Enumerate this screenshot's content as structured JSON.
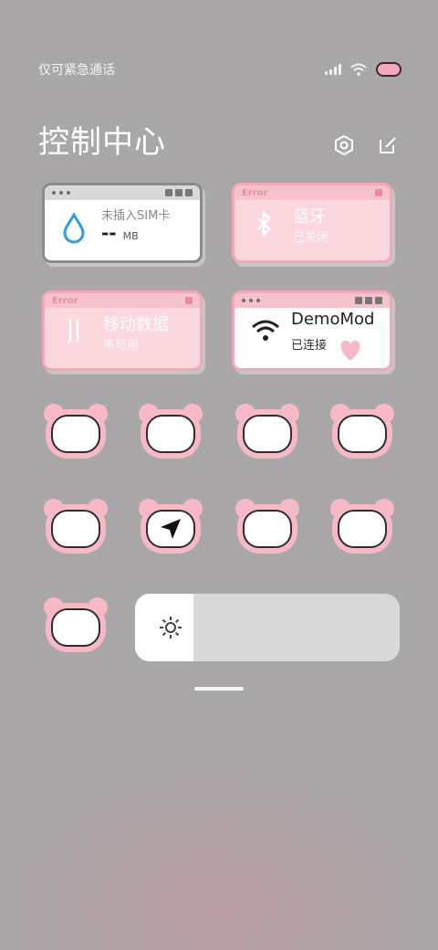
{
  "status": {
    "carrier": "仅可紧急通话"
  },
  "header": {
    "title": "控制中心"
  },
  "tiles": {
    "data": {
      "label": "未插入SIM卡",
      "value": "--",
      "unit": "MB"
    },
    "bluetooth": {
      "error": "Error",
      "name": "蓝牙",
      "state": "已关闭"
    },
    "mobile": {
      "error": "Error",
      "name": "移动数据",
      "state": "不可用"
    },
    "wifi": {
      "name": "DemoMod",
      "state": "已连接"
    }
  },
  "toggles": [
    {
      "name": "flashlight",
      "icon": "flashlight-icon",
      "active": false
    },
    {
      "name": "bell",
      "icon": "bell-icon",
      "active": false
    },
    {
      "name": "screenshot",
      "icon": "scissors-icon",
      "active": false
    },
    {
      "name": "airplane",
      "icon": "airplane-icon",
      "active": false
    },
    {
      "name": "lock",
      "icon": "lock-icon",
      "active": false
    },
    {
      "name": "location",
      "icon": "location-arrow-icon",
      "active": true
    },
    {
      "name": "rotation-lock",
      "icon": "rotation-lock-icon",
      "active": false
    },
    {
      "name": "minus",
      "icon": "minus-icon",
      "active": false
    },
    {
      "name": "auto-brightness",
      "icon": "auto-a-icon",
      "active": false
    }
  ],
  "brightness": {
    "level": 0.22,
    "icon": "sun-icon"
  },
  "colors": {
    "pink": "#f7b9c6",
    "background": "#a9a7a8",
    "accent": "#2f9be0"
  }
}
